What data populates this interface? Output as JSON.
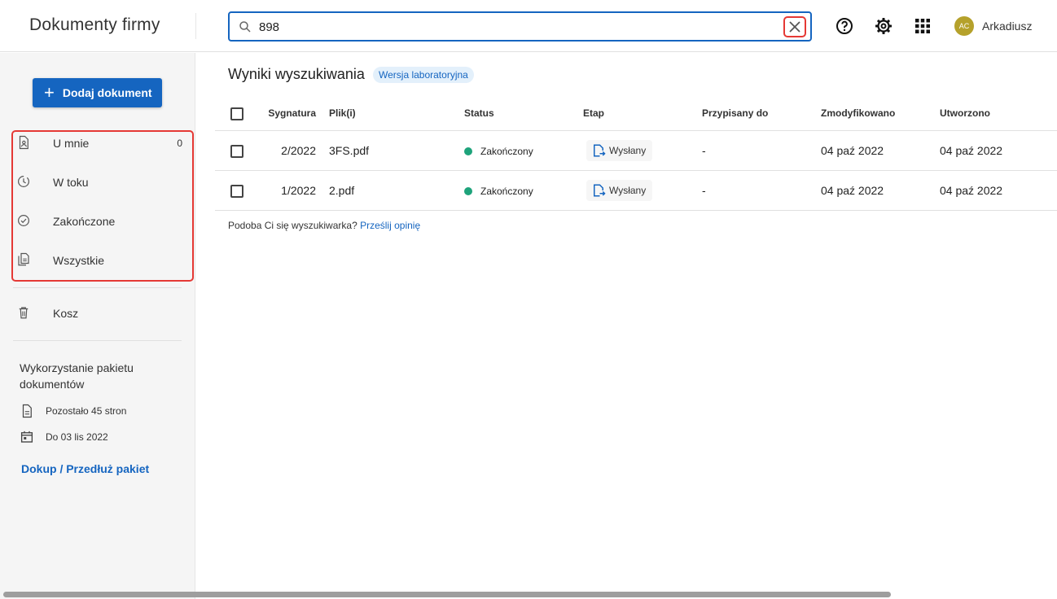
{
  "app": {
    "title": "Dokumenty firmy"
  },
  "search": {
    "value": "898"
  },
  "user": {
    "initials": "AC",
    "name": "Arkadiusz"
  },
  "sidebar": {
    "add_button": "Dodaj dokument",
    "items": [
      {
        "label": "U mnie",
        "count": "0"
      },
      {
        "label": "W toku"
      },
      {
        "label": "Zakończone"
      },
      {
        "label": "Wszystkie"
      },
      {
        "label": "Kosz"
      }
    ],
    "quota": {
      "title": "Wykorzystanie pakietu dokumentów",
      "pages_left": "Pozostało 45 stron",
      "valid_until": "Do 03 lis 2022",
      "link": "Dokup / Przedłuż pakiet"
    }
  },
  "main": {
    "title": "Wyniki wyszukiwania",
    "badge": "Wersja laboratoryjna",
    "columns": [
      "Sygnatura",
      "Plik(i)",
      "Status",
      "Etap",
      "Przypisany do",
      "Zmodyfikowano",
      "Utworzono"
    ],
    "rows": [
      {
        "signature": "2/2022",
        "file": "3FS.pdf",
        "status": "Zakończony",
        "stage": "Wysłany",
        "assigned": "-",
        "modified": "04 paź 2022",
        "created": "04 paź 2022"
      },
      {
        "signature": "1/2022",
        "file": "2.pdf",
        "status": "Zakończony",
        "stage": "Wysłany",
        "assigned": "-",
        "modified": "04 paź 2022",
        "created": "04 paź 2022"
      }
    ],
    "feedback": {
      "text": "Podoba Ci się wyszukiwarka?",
      "link": "Prześlij opinię"
    }
  },
  "colors": {
    "accent": "#1565c0",
    "status_done": "#1ea37b",
    "highlight": "#e53935",
    "avatar": "#b5a12b"
  }
}
